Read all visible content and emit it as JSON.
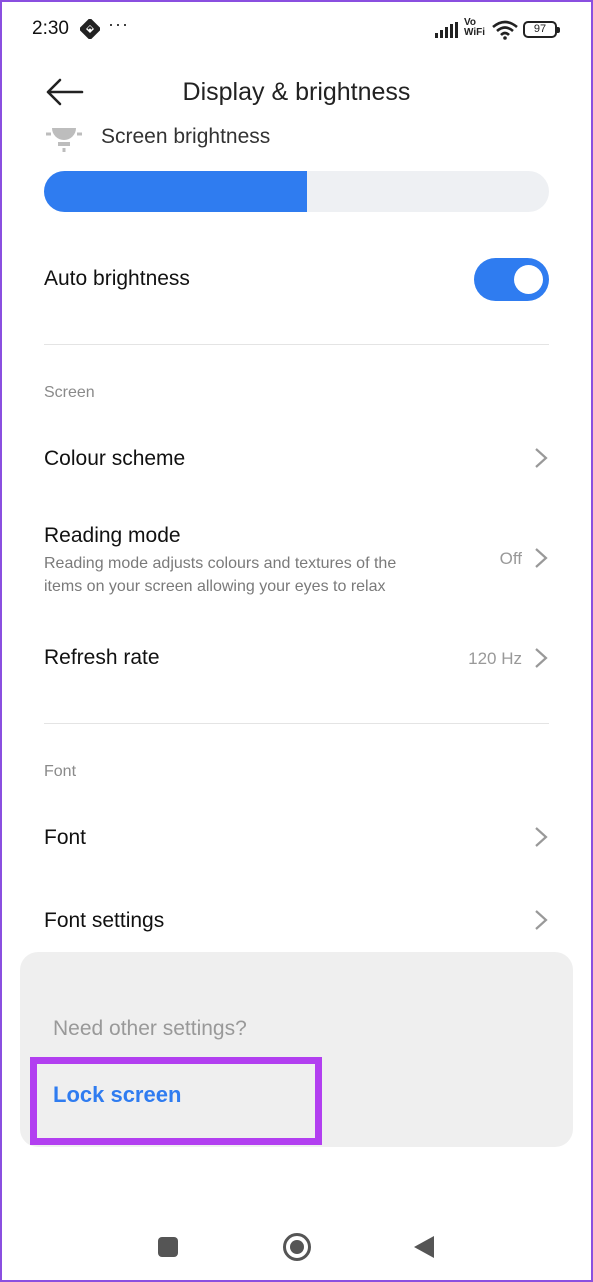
{
  "status_bar": {
    "time": "2:30",
    "dots": "···",
    "vowifi_top": "Vo",
    "vowifi_bottom": "WiFi",
    "battery": "97"
  },
  "header": {
    "title": "Display & brightness"
  },
  "brightness": {
    "label": "Screen brightness",
    "level": 0.52,
    "accent": "#2f7cf0"
  },
  "auto_brightness": {
    "label": "Auto brightness",
    "enabled": true
  },
  "screen_section": {
    "label": "Screen",
    "items": [
      {
        "title": "Colour scheme",
        "value": ""
      },
      {
        "title": "Reading mode",
        "subtitle_line1": "Reading mode adjusts colours and textures of the",
        "subtitle_line2": "items on your screen allowing your eyes to relax",
        "value": "Off"
      },
      {
        "title": "Refresh rate",
        "value": "120 Hz"
      }
    ]
  },
  "font_section": {
    "label": "Font",
    "items": [
      {
        "title": "Font"
      },
      {
        "title": "Font settings"
      }
    ]
  },
  "other_settings": {
    "hint": "Need other settings?",
    "link": "Lock screen"
  },
  "nav": {
    "icons": [
      "recent-apps-icon",
      "home-icon",
      "back-icon"
    ]
  }
}
